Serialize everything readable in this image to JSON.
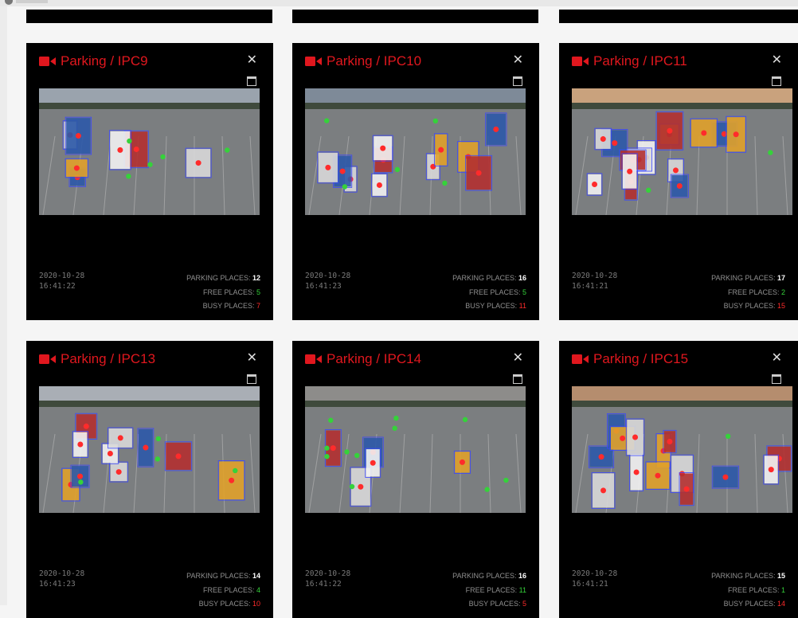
{
  "colors": {
    "accent": "#e0171e",
    "free": "#35d23a",
    "busy": "#ff2b2b",
    "card_bg": "#000000"
  },
  "icons": {
    "camera": "video-camera-icon",
    "close": "close-icon",
    "window": "window-icon"
  },
  "labels": {
    "parking": "PARKING PLACES: ",
    "free": "FREE PLACES: ",
    "busy": "BUSY PLACES: "
  },
  "cameras": [
    {
      "title": "Parking / IPC9",
      "date": "2020-10-28",
      "time": "16:41:22",
      "parking": "12",
      "free": "5",
      "busy": "7"
    },
    {
      "title": "Parking / IPC10",
      "date": "2020-10-28",
      "time": "16:41:23",
      "parking": "16",
      "free": "5",
      "busy": "11"
    },
    {
      "title": "Parking / IPC11",
      "date": "2020-10-28",
      "time": "16:41:21",
      "parking": "17",
      "free": "2",
      "busy": "15"
    },
    {
      "title": "Parking / IPC13",
      "date": "2020-10-28",
      "time": "16:41:23",
      "parking": "14",
      "free": "4",
      "busy": "10"
    },
    {
      "title": "Parking / IPC14",
      "date": "2020-10-28",
      "time": "16:41:22",
      "parking": "16",
      "free": "11",
      "busy": "5"
    },
    {
      "title": "Parking / IPC15",
      "date": "2020-10-28",
      "time": "16:41:21",
      "parking": "15",
      "free": "1",
      "busy": "14"
    }
  ]
}
